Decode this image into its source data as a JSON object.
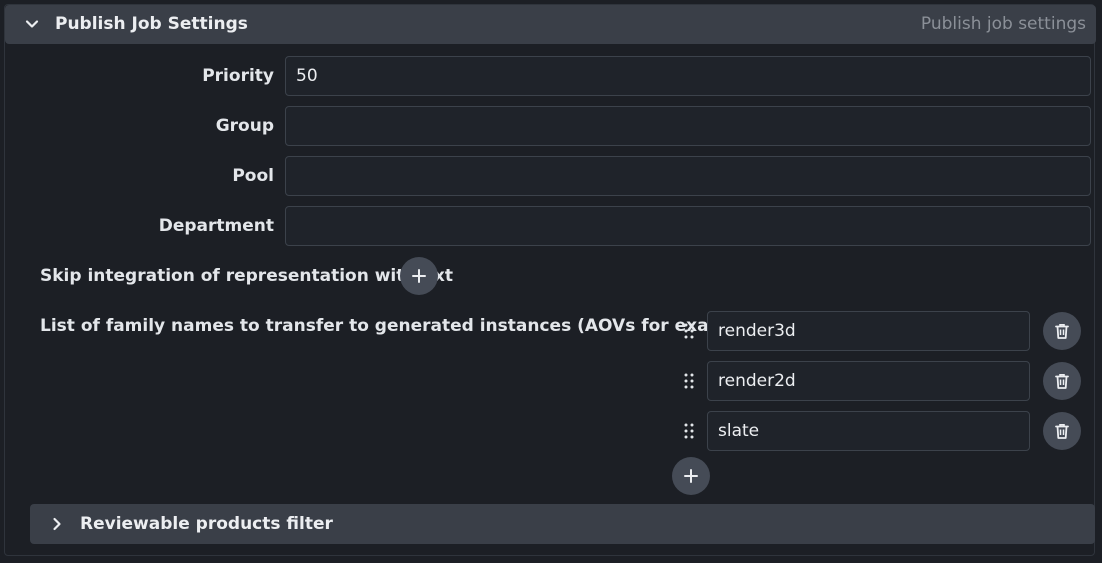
{
  "header": {
    "title": "Publish Job Settings",
    "description": "Publish job settings",
    "expanded": true
  },
  "fields": [
    {
      "label": "Priority",
      "value": "50"
    },
    {
      "label": "Group",
      "value": ""
    },
    {
      "label": "Pool",
      "value": ""
    },
    {
      "label": "Department",
      "value": ""
    }
  ],
  "skip_integration": {
    "label": "Skip integration of representation with ext",
    "add_icon": "plus-icon"
  },
  "families": {
    "label": "List of family names to transfer to generated instances (AOVs for example).",
    "items": [
      "render3d",
      "render2d",
      "slate"
    ],
    "item_icons": {
      "drag": "drag-handle-icon",
      "delete": "trash-icon"
    },
    "add_icon": "plus-icon"
  },
  "reviewable": {
    "title": "Reviewable products filter",
    "expanded": false
  },
  "colors": {
    "background": "#1c1f25",
    "header_bg": "#3a3f48",
    "button_bg": "#454b56",
    "input_border": "#3c424b",
    "muted_text": "#8b9098"
  }
}
